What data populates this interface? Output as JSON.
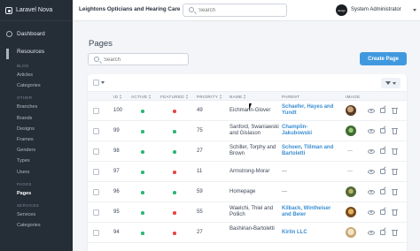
{
  "sidebar": {
    "brand": "Laravel Nova",
    "top_items": [
      {
        "label": "Dashboard",
        "icon": "dashboard-icon"
      },
      {
        "label": "Resources",
        "icon": "resources-grid-icon"
      }
    ],
    "sections": [
      {
        "title": "BLOG",
        "items": [
          "Articles",
          "Categories"
        ]
      },
      {
        "title": "OTHER",
        "items": [
          "Branches",
          "Brands",
          "Designs",
          "Frames",
          "Genders",
          "Types",
          "Users"
        ]
      },
      {
        "title": "PAGES",
        "items": [
          "Pages"
        ]
      },
      {
        "title": "SERVICES",
        "items": [
          "Services",
          "Categories"
        ]
      }
    ],
    "active_item": "Pages"
  },
  "topbar": {
    "app_title": "Leightons Opticians and Hearing Care",
    "search_placeholder": "Search",
    "avatar_text": "design",
    "user_name": "System Administrator"
  },
  "main": {
    "title": "Pages",
    "search_placeholder": "Search",
    "create_button": "Create Page",
    "columns": [
      "ID",
      "ACTIVE",
      "FEATURED",
      "PRIORITY",
      "NAME",
      "PARENT",
      "IMAGE"
    ],
    "rows": [
      {
        "id": "100",
        "active": "green",
        "featured": "red",
        "priority": "49",
        "name": "Eichmann-Glover",
        "parent": "Schaefer, Hayes and Yundt",
        "image": "thumb-brown"
      },
      {
        "id": "99",
        "active": "green",
        "featured": "green",
        "priority": "75",
        "name": "Sanford, Swaniawski and Gislason",
        "parent": "Champlin-Jakubowski",
        "image": "thumb-green"
      },
      {
        "id": "98",
        "active": "green",
        "featured": "green",
        "priority": "27",
        "name": "Schiller, Torphy and Brown",
        "parent": "Schoen, Tillman and Bartoletti",
        "image": "—"
      },
      {
        "id": "97",
        "active": "green",
        "featured": "red",
        "priority": "11",
        "name": "Armstrong-Morar",
        "parent": "—",
        "image": "—"
      },
      {
        "id": "96",
        "active": "green",
        "featured": "green",
        "priority": "59",
        "name": "Homepage",
        "parent": "—",
        "image": "thumb-olive"
      },
      {
        "id": "95",
        "active": "green",
        "featured": "red",
        "priority": "55",
        "name": "Waelchi, Thiel and Pollich",
        "parent": "Kilback, Wintheiser and Beier",
        "image": "thumb-amber"
      },
      {
        "id": "94",
        "active": "green",
        "featured": "red",
        "priority": "27",
        "name": "Bashirian-Bartoletti",
        "parent": "Kirlin LLC",
        "image": "thumb-beige"
      }
    ]
  },
  "colors": {
    "sidebar_bg": "#252d37",
    "accent": "#4099de",
    "link": "#3b8fd2",
    "status_green": "#2bb673",
    "status_red": "#e74444"
  }
}
